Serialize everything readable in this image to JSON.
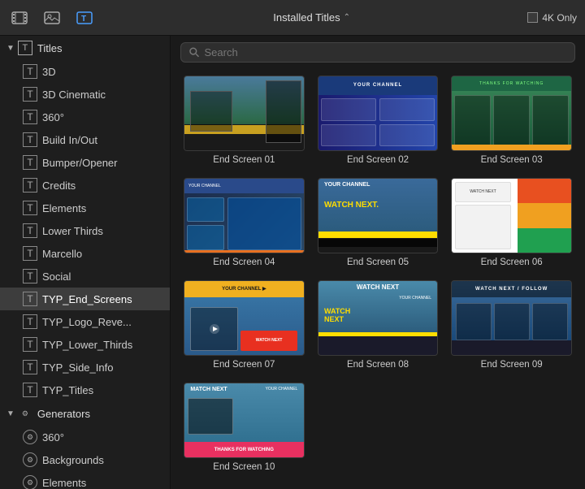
{
  "toolbar": {
    "title": "Installed Titles",
    "chevron": "⌃",
    "fourk_label": "4K Only",
    "icons": [
      {
        "name": "film-icon",
        "glyph": "🎬"
      },
      {
        "name": "photo-icon",
        "glyph": "📷"
      },
      {
        "name": "titles-icon",
        "glyph": "T"
      }
    ]
  },
  "search": {
    "placeholder": "Search"
  },
  "sidebar": {
    "titles_section": {
      "label": "Titles",
      "expanded": true,
      "items": [
        {
          "id": "3d",
          "label": "3D"
        },
        {
          "id": "3d-cinematic",
          "label": "3D Cinematic"
        },
        {
          "id": "360",
          "label": "360°"
        },
        {
          "id": "build-in-out",
          "label": "Build In/Out"
        },
        {
          "id": "bumper-opener",
          "label": "Bumper/Opener"
        },
        {
          "id": "credits",
          "label": "Credits"
        },
        {
          "id": "elements",
          "label": "Elements"
        },
        {
          "id": "lower-thirds",
          "label": "Lower Thirds"
        },
        {
          "id": "marcello",
          "label": "Marcello"
        },
        {
          "id": "social",
          "label": "Social"
        },
        {
          "id": "typ-end-screens",
          "label": "TYP_End_Screens",
          "active": true
        },
        {
          "id": "typ-logo-reve",
          "label": "TYP_Logo_Reve..."
        },
        {
          "id": "typ-lower-thirds",
          "label": "TYP_Lower_Thirds"
        },
        {
          "id": "typ-side-info",
          "label": "TYP_Side_Info"
        },
        {
          "id": "typ-titles",
          "label": "TYP_Titles"
        }
      ]
    },
    "generators_section": {
      "label": "Generators",
      "expanded": true,
      "items": [
        {
          "id": "gen-360",
          "label": "360°"
        },
        {
          "id": "backgrounds",
          "label": "Backgrounds"
        },
        {
          "id": "elements-gen",
          "label": "Elements"
        }
      ]
    }
  },
  "grid": {
    "items": [
      {
        "id": "es01",
        "label": "End Screen 01"
      },
      {
        "id": "es02",
        "label": "End Screen 02"
      },
      {
        "id": "es03",
        "label": "End Screen 03"
      },
      {
        "id": "es04",
        "label": "End Screen 04"
      },
      {
        "id": "es05",
        "label": "End Screen 05"
      },
      {
        "id": "es06",
        "label": "End Screen 06"
      },
      {
        "id": "es07",
        "label": "End Screen 07"
      },
      {
        "id": "es08",
        "label": "End Screen 08"
      },
      {
        "id": "es09",
        "label": "End Screen 09"
      },
      {
        "id": "es10",
        "label": "End Screen 10"
      }
    ]
  }
}
